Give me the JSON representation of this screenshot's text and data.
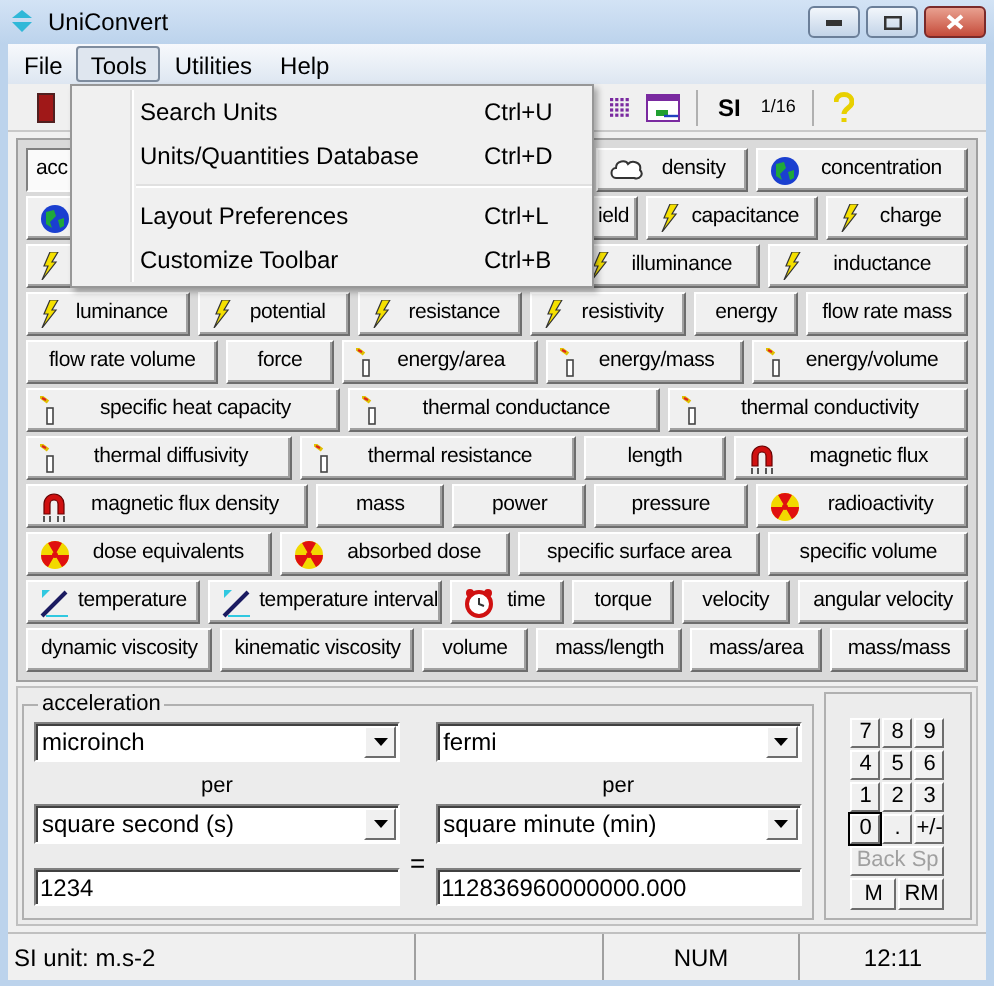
{
  "window": {
    "title": "UniConvert"
  },
  "menu": [
    {
      "label": "File",
      "selected": false
    },
    {
      "label": "Tools",
      "selected": true
    },
    {
      "label": "Utilities",
      "selected": false
    },
    {
      "label": "Help",
      "selected": false
    }
  ],
  "dropdown": [
    {
      "kind": "item",
      "label": "Search Units",
      "shortcut": "Ctrl+U"
    },
    {
      "kind": "item",
      "label": "Units/Quantities Database",
      "shortcut": "Ctrl+D"
    },
    {
      "kind": "separator"
    },
    {
      "kind": "item",
      "label": "Layout Preferences",
      "shortcut": "Ctrl+L"
    },
    {
      "kind": "item",
      "label": "Customize Toolbar",
      "shortcut": "Ctrl+B"
    }
  ],
  "toolbar": {
    "system": "SI",
    "fraction": "1/16"
  },
  "rows": [
    {
      "buttons": [
        {
          "label": "acc",
          "selected": true
        },
        {
          "label": "density",
          "kind": "blob",
          "selected": false
        },
        {
          "label": "concentration",
          "kind": "globe",
          "selected": false
        }
      ]
    },
    {
      "buttons": [
        {
          "kind": "globe",
          "selected": false
        },
        {
          "label": "ield",
          "selected": false
        },
        {
          "label": "capacitance",
          "kind": "bolt",
          "selected": false
        },
        {
          "label": "charge",
          "kind": "bolt",
          "selected": false
        }
      ]
    },
    {
      "buttons": [
        {
          "kind": "bolt",
          "selected": false
        },
        {
          "label": "illuminance",
          "kind": "bolt",
          "selected": false
        },
        {
          "label": "inductance",
          "kind": "bolt",
          "selected": false
        }
      ]
    },
    {
      "buttons": [
        {
          "label": "luminance",
          "kind": "bolt",
          "selected": false
        },
        {
          "label": "potential",
          "kind": "bolt",
          "selected": false
        },
        {
          "label": "resistance",
          "kind": "bolt",
          "selected": false
        },
        {
          "label": "resistivity",
          "kind": "bolt",
          "selected": false
        },
        {
          "label": "energy",
          "selected": false
        },
        {
          "label": "flow rate mass",
          "selected": false
        }
      ]
    },
    {
      "buttons": [
        {
          "label": "flow rate volume",
          "selected": false
        },
        {
          "label": "force",
          "selected": false
        },
        {
          "label": "energy/area",
          "kind": "thermo",
          "selected": false
        },
        {
          "label": "energy/mass",
          "kind": "thermo",
          "selected": false
        },
        {
          "label": "energy/volume",
          "kind": "thermo",
          "selected": false
        }
      ]
    },
    {
      "buttons": [
        {
          "label": "specific heat capacity",
          "kind": "thermo",
          "selected": false
        },
        {
          "label": "thermal conductance",
          "kind": "thermo",
          "selected": false
        },
        {
          "label": "thermal conductivity",
          "kind": "thermo",
          "selected": false
        }
      ]
    },
    {
      "buttons": [
        {
          "label": "thermal diffusivity",
          "kind": "thermo",
          "selected": false
        },
        {
          "label": "thermal resistance",
          "kind": "thermo",
          "selected": false
        },
        {
          "label": "length",
          "selected": false
        },
        {
          "label": "magnetic flux",
          "kind": "magnet",
          "selected": false
        }
      ]
    },
    {
      "buttons": [
        {
          "label": "magnetic flux density",
          "kind": "magnet",
          "selected": false
        },
        {
          "label": "mass",
          "selected": false
        },
        {
          "label": "power",
          "selected": false
        },
        {
          "label": "pressure",
          "selected": false
        },
        {
          "label": "radioactivity",
          "kind": "radiation",
          "selected": false
        }
      ]
    },
    {
      "buttons": [
        {
          "label": "dose equivalents",
          "kind": "radiation",
          "selected": false
        },
        {
          "label": "absorbed dose",
          "kind": "radiation",
          "selected": false
        },
        {
          "label": "specific surface area",
          "selected": false
        },
        {
          "label": "specific volume",
          "selected": false
        }
      ]
    },
    {
      "buttons": [
        {
          "label": "temperature",
          "kind": "pen",
          "selected": false
        },
        {
          "label": "temperature interval",
          "kind": "pen",
          "selected": false
        },
        {
          "label": "time",
          "kind": "clock",
          "selected": false
        },
        {
          "label": "torque",
          "selected": false
        },
        {
          "label": "velocity",
          "selected": false
        },
        {
          "label": "angular velocity",
          "selected": false
        }
      ]
    },
    {
      "buttons": [
        {
          "label": "dynamic viscosity",
          "selected": false
        },
        {
          "label": "kinematic viscosity",
          "selected": false
        },
        {
          "label": "volume",
          "selected": false
        },
        {
          "label": "mass/length",
          "selected": false
        },
        {
          "label": "mass/area",
          "selected": false
        },
        {
          "label": "mass/mass",
          "selected": false
        }
      ]
    }
  ],
  "converter": {
    "quantity": "acceleration",
    "equals": "=",
    "from": {
      "unit": "microinch",
      "per": "per",
      "per_unit": "square second (s)",
      "value": "1234"
    },
    "to": {
      "unit": "fermi",
      "per": "per",
      "per_unit": "square minute (min)",
      "value": "112836960000000.000"
    }
  },
  "keypad": {
    "keys": [
      {
        "label": "7",
        "focused": false
      },
      {
        "label": "8",
        "focused": false
      },
      {
        "label": "9",
        "focused": false
      },
      {
        "label": "4",
        "focused": false
      },
      {
        "label": "5",
        "focused": false
      },
      {
        "label": "6",
        "focused": false
      },
      {
        "label": "1",
        "focused": false
      },
      {
        "label": "2",
        "focused": false
      },
      {
        "label": "3",
        "focused": false
      },
      {
        "label": "0",
        "focused": true
      },
      {
        "label": ".",
        "focused": false
      },
      {
        "label": "+/-",
        "focused": false
      }
    ],
    "backspace": {
      "label": "Back Sp",
      "disabled": true
    },
    "memory": [
      {
        "label": "M"
      },
      {
        "label": "RM"
      }
    ]
  },
  "status_bar": {
    "unit": "SI unit: m.s-2",
    "mode": "NUM",
    "time": "12:11"
  }
}
